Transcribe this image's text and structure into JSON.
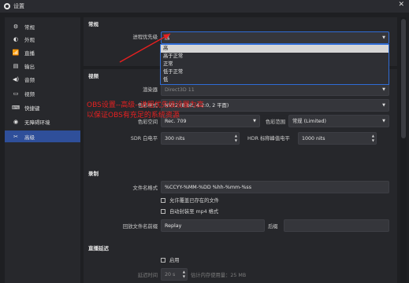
{
  "window": {
    "title": "设置",
    "close_glyph": "✕"
  },
  "sidebar": {
    "items": [
      {
        "label": "常规",
        "icon": "gear-icon",
        "glyph": "⚙"
      },
      {
        "label": "外观",
        "icon": "palette-icon",
        "glyph": "◐"
      },
      {
        "label": "直播",
        "icon": "broadcast-icon",
        "glyph": "📶"
      },
      {
        "label": "输出",
        "icon": "output-icon",
        "glyph": "▤"
      },
      {
        "label": "音频",
        "icon": "speaker-icon",
        "glyph": "◀)"
      },
      {
        "label": "视频",
        "icon": "monitor-icon",
        "glyph": "▭"
      },
      {
        "label": "快捷键",
        "icon": "keyboard-icon",
        "glyph": "⌨"
      },
      {
        "label": "无障碍环境",
        "icon": "accessibility-icon",
        "glyph": "◉"
      },
      {
        "label": "高级",
        "icon": "wrench-icon",
        "glyph": "✂"
      }
    ],
    "active_index": 8
  },
  "general": {
    "title": "常规",
    "priority_label": "进程优先级",
    "priority_value": "高",
    "priority_options": [
      "高",
      "高于正常",
      "正常",
      "低于正常",
      "低"
    ],
    "selected_option": 0
  },
  "video": {
    "title": "视频",
    "renderer_label": "渲染器",
    "renderer_value": "Direct3D 11",
    "color_format_label": "色彩格式",
    "color_format_value": "NV12 (8-bit, 4:2:0, 2 平面)",
    "color_space_label": "色彩空间",
    "color_space_value": "Rec. 709",
    "color_range_label": "色彩范围",
    "color_range_value": "常规 (Limited)",
    "sdr_label": "SDR 白电平",
    "sdr_value": "300 nits",
    "hdr_label": "HDR 标称峰值电平",
    "hdr_value": "1000 nits"
  },
  "recording": {
    "title": "录制",
    "filename_label": "文件名格式",
    "filename_value": "%CCYY-%MM-%DD %hh-%mm-%ss",
    "overwrite_label": "允许覆盖已存在的文件",
    "remux_label": "自动封装至 mp4 格式",
    "replay_prefix_label": "回放文件名前缀",
    "replay_prefix_value": "Replay",
    "suffix_label": "后缀",
    "suffix_value": ""
  },
  "stream_delay": {
    "title": "直播延迟",
    "enable_label": "启用",
    "delay_label": "延迟时间",
    "delay_value": "20 s",
    "memory_label": "估计内存使用量：25 MB"
  },
  "annotation": {
    "line1": "OBS设置--高级--进程优先级设置为高",
    "line2": "以保证OBS有充足的系统资源"
  },
  "colors": {
    "accent": "#2f4f9a",
    "annotation": "#e62020",
    "dropdown_border": "#2f6cd6"
  }
}
